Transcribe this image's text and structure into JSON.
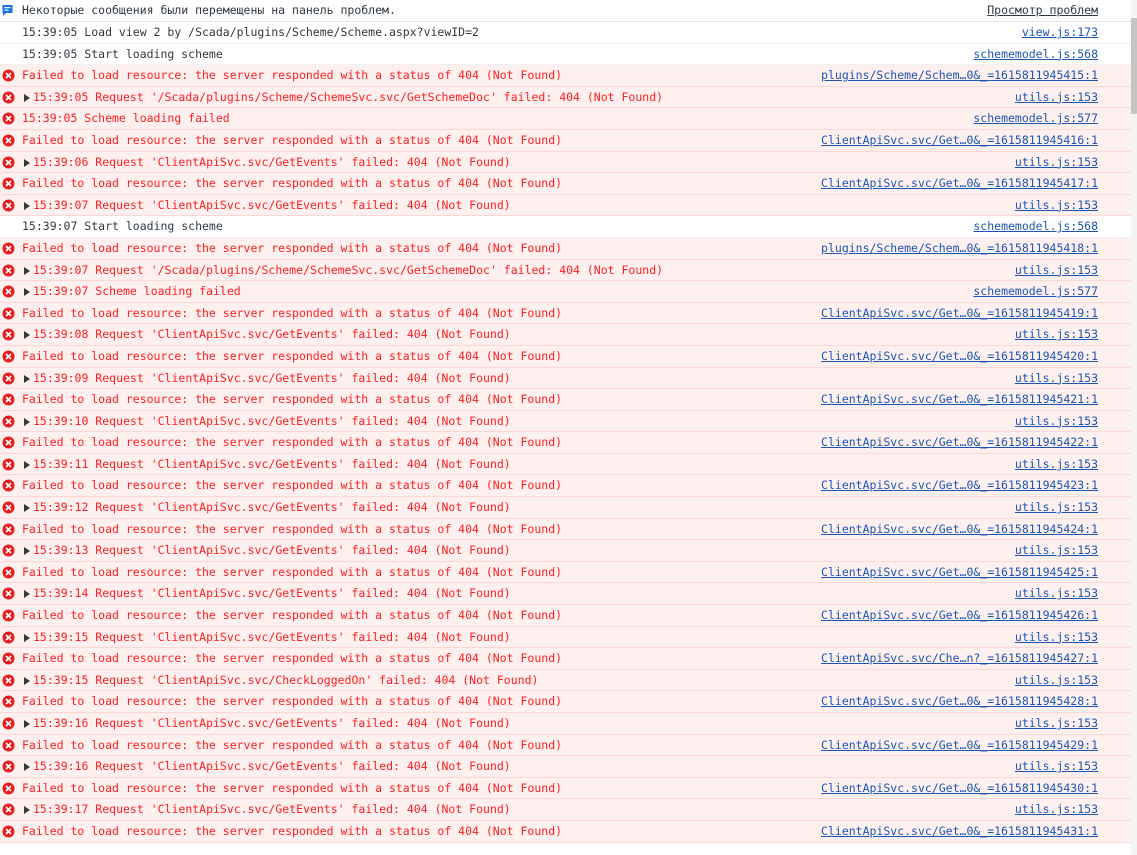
{
  "issues_banner": {
    "message": "Некоторые сообщения были перемещены на панель проблем.",
    "link": "Просмотр проблем"
  },
  "entries": [
    {
      "level": "info",
      "expandable": false,
      "message": "15:39:05 Load view 2 by /Scada/plugins/Scheme/Scheme.aspx?viewID=2",
      "source": "view.js:173"
    },
    {
      "level": "info",
      "expandable": false,
      "message": "15:39:05 Start loading scheme",
      "source": "schememodel.js:568"
    },
    {
      "level": "error",
      "expandable": false,
      "message": "Failed to load resource: the server responded with a status of 404 (Not Found)",
      "source": "plugins/Scheme/Schem…0&_=1615811945415:1"
    },
    {
      "level": "error",
      "expandable": true,
      "message": "15:39:05 Request '/Scada/plugins/Scheme/SchemeSvc.svc/GetSchemeDoc' failed: 404 (Not Found)",
      "source": "utils.js:153"
    },
    {
      "level": "error",
      "expandable": false,
      "message": "15:39:05 Scheme loading failed",
      "source": "schememodel.js:577"
    },
    {
      "level": "error",
      "expandable": false,
      "message": "Failed to load resource: the server responded with a status of 404 (Not Found)",
      "source": "ClientApiSvc.svc/Get…0&_=1615811945416:1"
    },
    {
      "level": "error",
      "expandable": true,
      "message": "15:39:06 Request 'ClientApiSvc.svc/GetEvents' failed: 404 (Not Found)",
      "source": "utils.js:153"
    },
    {
      "level": "error",
      "expandable": false,
      "message": "Failed to load resource: the server responded with a status of 404 (Not Found)",
      "source": "ClientApiSvc.svc/Get…0&_=1615811945417:1"
    },
    {
      "level": "error",
      "expandable": true,
      "message": "15:39:07 Request 'ClientApiSvc.svc/GetEvents' failed: 404 (Not Found)",
      "source": "utils.js:153"
    },
    {
      "level": "info",
      "expandable": false,
      "message": "15:39:07 Start loading scheme",
      "source": "schememodel.js:568"
    },
    {
      "level": "error",
      "expandable": false,
      "message": "Failed to load resource: the server responded with a status of 404 (Not Found)",
      "source": "plugins/Scheme/Schem…0&_=1615811945418:1"
    },
    {
      "level": "error",
      "expandable": true,
      "message": "15:39:07 Request '/Scada/plugins/Scheme/SchemeSvc.svc/GetSchemeDoc' failed: 404 (Not Found)",
      "source": "utils.js:153"
    },
    {
      "level": "error",
      "expandable": true,
      "message": "15:39:07 Scheme loading failed",
      "source": "schememodel.js:577"
    },
    {
      "level": "error",
      "expandable": false,
      "message": "Failed to load resource: the server responded with a status of 404 (Not Found)",
      "source": "ClientApiSvc.svc/Get…0&_=1615811945419:1"
    },
    {
      "level": "error",
      "expandable": true,
      "message": "15:39:08 Request 'ClientApiSvc.svc/GetEvents' failed: 404 (Not Found)",
      "source": "utils.js:153"
    },
    {
      "level": "error",
      "expandable": false,
      "message": "Failed to load resource: the server responded with a status of 404 (Not Found)",
      "source": "ClientApiSvc.svc/Get…0&_=1615811945420:1"
    },
    {
      "level": "error",
      "expandable": true,
      "message": "15:39:09 Request 'ClientApiSvc.svc/GetEvents' failed: 404 (Not Found)",
      "source": "utils.js:153"
    },
    {
      "level": "error",
      "expandable": false,
      "message": "Failed to load resource: the server responded with a status of 404 (Not Found)",
      "source": "ClientApiSvc.svc/Get…0&_=1615811945421:1"
    },
    {
      "level": "error",
      "expandable": true,
      "message": "15:39:10 Request 'ClientApiSvc.svc/GetEvents' failed: 404 (Not Found)",
      "source": "utils.js:153"
    },
    {
      "level": "error",
      "expandable": false,
      "message": "Failed to load resource: the server responded with a status of 404 (Not Found)",
      "source": "ClientApiSvc.svc/Get…0&_=1615811945422:1"
    },
    {
      "level": "error",
      "expandable": true,
      "message": "15:39:11 Request 'ClientApiSvc.svc/GetEvents' failed: 404 (Not Found)",
      "source": "utils.js:153"
    },
    {
      "level": "error",
      "expandable": false,
      "message": "Failed to load resource: the server responded with a status of 404 (Not Found)",
      "source": "ClientApiSvc.svc/Get…0&_=1615811945423:1"
    },
    {
      "level": "error",
      "expandable": true,
      "message": "15:39:12 Request 'ClientApiSvc.svc/GetEvents' failed: 404 (Not Found)",
      "source": "utils.js:153"
    },
    {
      "level": "error",
      "expandable": false,
      "message": "Failed to load resource: the server responded with a status of 404 (Not Found)",
      "source": "ClientApiSvc.svc/Get…0&_=1615811945424:1"
    },
    {
      "level": "error",
      "expandable": true,
      "message": "15:39:13 Request 'ClientApiSvc.svc/GetEvents' failed: 404 (Not Found)",
      "source": "utils.js:153"
    },
    {
      "level": "error",
      "expandable": false,
      "message": "Failed to load resource: the server responded with a status of 404 (Not Found)",
      "source": "ClientApiSvc.svc/Get…0&_=1615811945425:1"
    },
    {
      "level": "error",
      "expandable": true,
      "message": "15:39:14 Request 'ClientApiSvc.svc/GetEvents' failed: 404 (Not Found)",
      "source": "utils.js:153"
    },
    {
      "level": "error",
      "expandable": false,
      "message": "Failed to load resource: the server responded with a status of 404 (Not Found)",
      "source": "ClientApiSvc.svc/Get…0&_=1615811945426:1"
    },
    {
      "level": "error",
      "expandable": true,
      "message": "15:39:15 Request 'ClientApiSvc.svc/GetEvents' failed: 404 (Not Found)",
      "source": "utils.js:153"
    },
    {
      "level": "error",
      "expandable": false,
      "message": "Failed to load resource: the server responded with a status of 404 (Not Found)",
      "source": "ClientApiSvc.svc/Che…n?_=1615811945427:1"
    },
    {
      "level": "error",
      "expandable": true,
      "message": "15:39:15 Request 'ClientApiSvc.svc/CheckLoggedOn' failed: 404 (Not Found)",
      "source": "utils.js:153"
    },
    {
      "level": "error",
      "expandable": false,
      "message": "Failed to load resource: the server responded with a status of 404 (Not Found)",
      "source": "ClientApiSvc.svc/Get…0&_=1615811945428:1"
    },
    {
      "level": "error",
      "expandable": true,
      "message": "15:39:16 Request 'ClientApiSvc.svc/GetEvents' failed: 404 (Not Found)",
      "source": "utils.js:153"
    },
    {
      "level": "error",
      "expandable": false,
      "message": "Failed to load resource: the server responded with a status of 404 (Not Found)",
      "source": "ClientApiSvc.svc/Get…0&_=1615811945429:1"
    },
    {
      "level": "error",
      "expandable": true,
      "message": "15:39:16 Request 'ClientApiSvc.svc/GetEvents' failed: 404 (Not Found)",
      "source": "utils.js:153"
    },
    {
      "level": "error",
      "expandable": false,
      "message": "Failed to load resource: the server responded with a status of 404 (Not Found)",
      "source": "ClientApiSvc.svc/Get…0&_=1615811945430:1"
    },
    {
      "level": "error",
      "expandable": true,
      "message": "15:39:17 Request 'ClientApiSvc.svc/GetEvents' failed: 404 (Not Found)",
      "source": "utils.js:153"
    },
    {
      "level": "error",
      "expandable": false,
      "message": "Failed to load resource: the server responded with a status of 404 (Not Found)",
      "source": "ClientApiSvc.svc/Get…0&_=1615811945431:1"
    }
  ],
  "colors": {
    "error_text": "#fe2020",
    "error_background": "#fff0f0",
    "link": "#1a55b4",
    "issues_icon": "#1a73e8"
  }
}
